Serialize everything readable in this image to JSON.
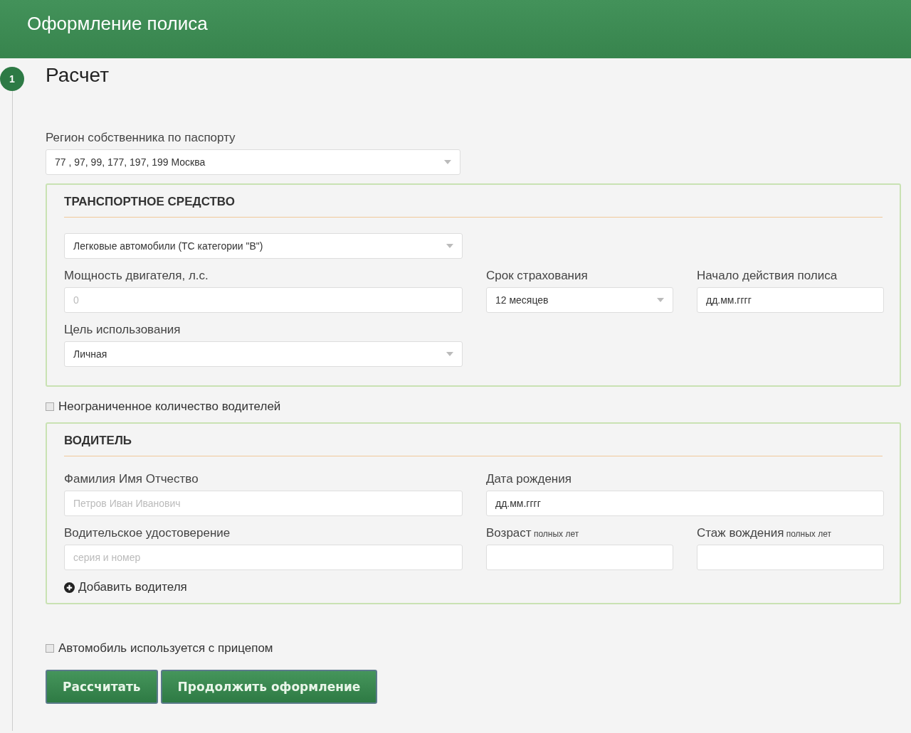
{
  "header": {
    "title": "Оформление полиса"
  },
  "step": {
    "number": "1",
    "title": "Расчет"
  },
  "region": {
    "label": "Регион собственника по паспорту",
    "kind": "select",
    "value": "77 , 97, 99, 177, 197, 199 Москва"
  },
  "vehicle": {
    "title": "ТРАНСПОРТНОЕ СРЕДСТВО",
    "rows": [
      [
        {
          "kind": "select",
          "value": "Легковые автомобили (ТС категории \"В\")"
        }
      ],
      [
        {
          "label": "Мощность двигателя, л.с.",
          "kind": "input",
          "placeholder": "0"
        },
        {
          "label": "Срок страхования",
          "kind": "select",
          "value": "12 месяцев"
        },
        {
          "label": "Начало действия полиса",
          "kind": "input",
          "value": "дд.мм.гггг"
        }
      ],
      [
        {
          "label": "Цель использования",
          "kind": "select",
          "value": "Личная"
        }
      ]
    ]
  },
  "unlimited_drivers": {
    "label": "Неограниченное количество водителей",
    "checked": false
  },
  "driver": {
    "title": "ВОДИТЕЛЬ",
    "rows": [
      [
        {
          "label": "Фамилия Имя Отчество",
          "kind": "input",
          "placeholder": "Петров Иван Иванович"
        },
        {
          "label": "Дата рождения",
          "kind": "input",
          "value": "дд.мм.гггг"
        }
      ],
      [
        {
          "label": "Водительское удостоверение",
          "kind": "input",
          "placeholder": "серия и номер"
        },
        {
          "label": "Возраст",
          "hint": "полных лет",
          "kind": "input"
        },
        {
          "label": "Стаж вождения",
          "hint": "полных лет",
          "kind": "input"
        }
      ]
    ],
    "add_link": "Добавить водителя"
  },
  "trailer": {
    "label": "Автомобиль используется с прицепом",
    "checked": false
  },
  "buttons": [
    "Рассчитать",
    "Продолжить оформление"
  ]
}
